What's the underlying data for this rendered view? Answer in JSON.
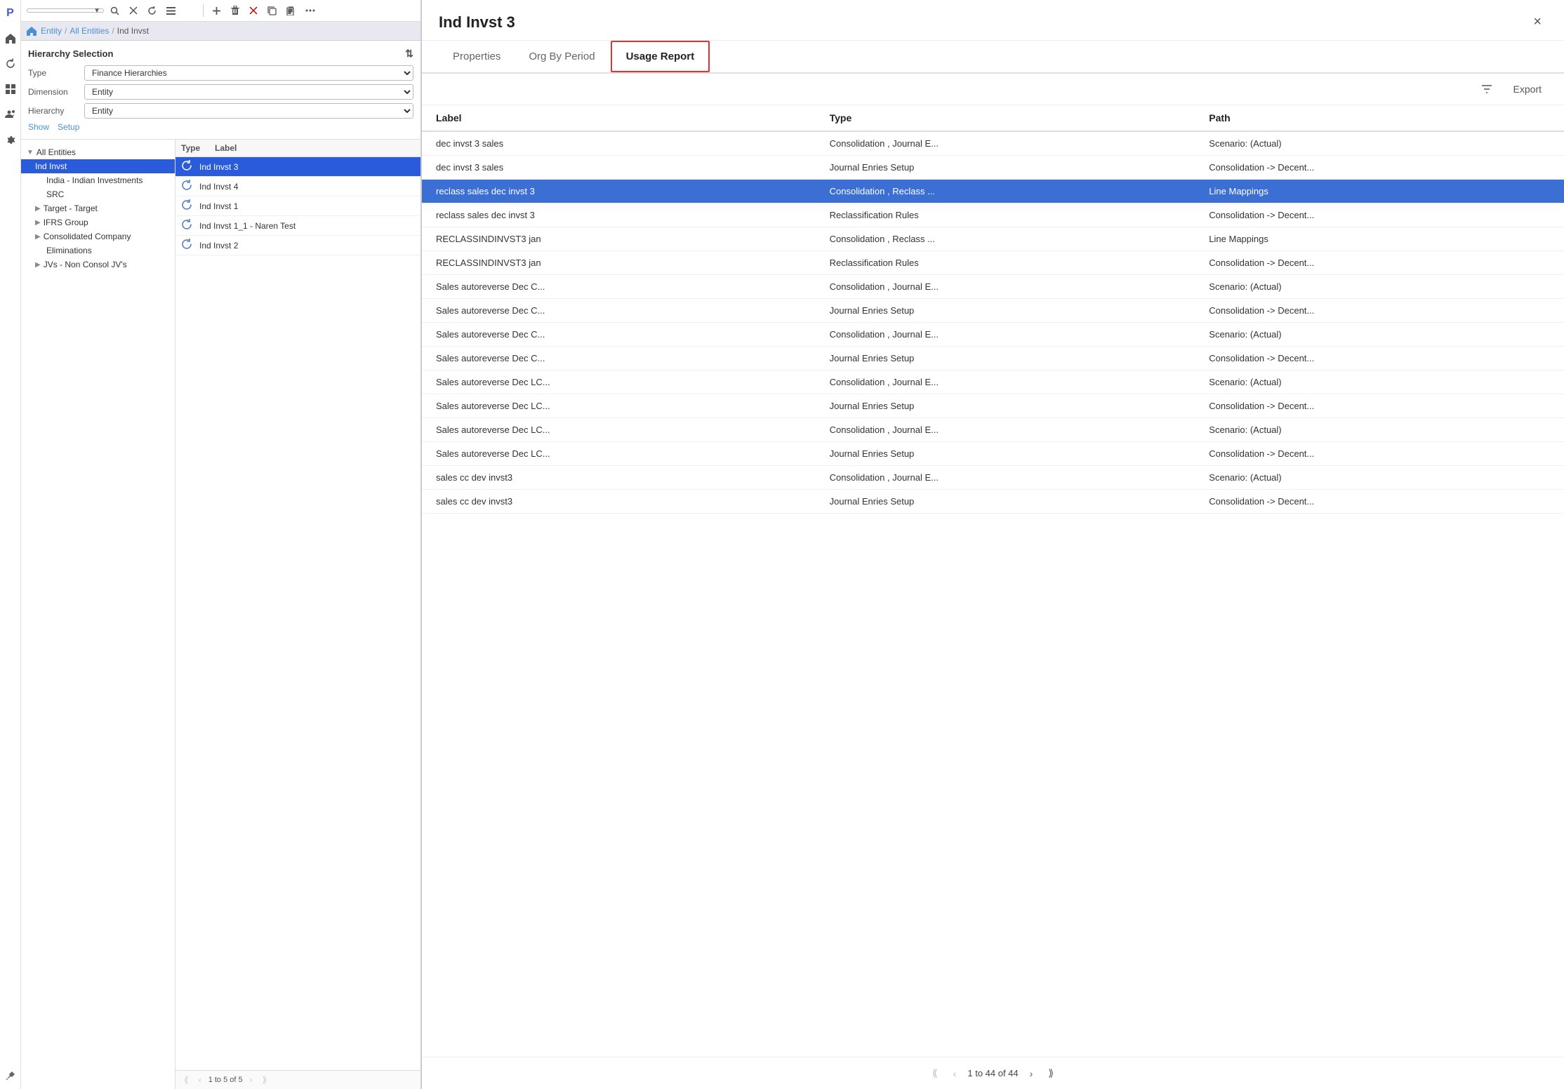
{
  "app": {
    "title": "Ind Invst 3"
  },
  "nav": {
    "icons": [
      "P",
      "🏠",
      "↺",
      "⊞",
      "👤",
      "⚙"
    ]
  },
  "toolbar": {
    "dropdown_placeholder": "",
    "buttons": [
      "search",
      "clear",
      "refresh",
      "list",
      "sort",
      "add",
      "delete",
      "x-red",
      "copy",
      "paste",
      "more"
    ]
  },
  "breadcrumb": {
    "items": [
      "Entity",
      "All Entities",
      "Ind Invst"
    ]
  },
  "hierarchy": {
    "title": "Hierarchy Selection",
    "type_label": "Type",
    "type_value": "Finance Hierarchies",
    "dimension_label": "Dimension",
    "dimension_value": "Entity",
    "hierarchy_label": "Hierarchy",
    "hierarchy_value": "Entity",
    "actions": [
      "Show",
      "Setup"
    ]
  },
  "list_header": {
    "type": "Type",
    "label": "Label"
  },
  "tree": {
    "items": [
      {
        "label": "All Entities",
        "level": 0,
        "expanded": true,
        "arrow": "▼"
      },
      {
        "label": "Ind Invst",
        "level": 1,
        "selected": true,
        "arrow": ""
      },
      {
        "label": "India - Indian Investments",
        "level": 2,
        "arrow": ""
      },
      {
        "label": "SRC",
        "level": 2,
        "arrow": ""
      },
      {
        "label": "Target - Target",
        "level": 1,
        "arrow": "▶"
      },
      {
        "label": "IFRS Group",
        "level": 1,
        "arrow": "▶"
      },
      {
        "label": "Consolidated Company",
        "level": 1,
        "arrow": "▶"
      },
      {
        "label": "Eliminations",
        "level": 2,
        "arrow": ""
      },
      {
        "label": "JVs - Non Consol JV's",
        "level": 1,
        "arrow": "▶"
      }
    ]
  },
  "list_rows": [
    {
      "icon": "🔁",
      "label": "Ind Invst 3",
      "selected": true
    },
    {
      "icon": "🔁",
      "label": "Ind Invst 4"
    },
    {
      "icon": "🔁",
      "label": "Ind Invst 1"
    },
    {
      "icon": "🔁",
      "label": "Ind Invst 1_1 - Naren Test"
    },
    {
      "icon": "🔁",
      "label": "Ind Invst 2"
    }
  ],
  "list_footer": {
    "pagination": "1 to 5 of 5"
  },
  "dialog": {
    "title": "Ind Invst 3",
    "close_label": "×",
    "tabs": [
      {
        "label": "Properties",
        "active": false
      },
      {
        "label": "Org By Period",
        "active": false
      },
      {
        "label": "Usage Report",
        "active": true
      }
    ]
  },
  "table_toolbar": {
    "filter_label": "Filter",
    "export_label": "Export"
  },
  "table": {
    "columns": [
      {
        "key": "label",
        "header": "Label"
      },
      {
        "key": "type",
        "header": "Type"
      },
      {
        "key": "path",
        "header": "Path"
      }
    ],
    "rows": [
      {
        "label": "dec invst 3 sales",
        "type": "Consolidation , Journal E...",
        "path": "Scenario: (Actual)",
        "selected": false
      },
      {
        "label": "dec invst 3 sales",
        "type": "Journal Enries Setup",
        "path": "Consolidation -> Decent...",
        "selected": false
      },
      {
        "label": "reclass sales dec invst 3",
        "type": "Consolidation , Reclass ...",
        "path": "Line Mappings",
        "selected": true
      },
      {
        "label": "reclass sales dec invst 3",
        "type": "Reclassification Rules",
        "path": "Consolidation -> Decent...",
        "selected": false
      },
      {
        "label": "RECLASSINDINVST3 jan",
        "type": "Consolidation , Reclass ...",
        "path": "Line Mappings",
        "selected": false
      },
      {
        "label": "RECLASSINDINVST3 jan",
        "type": "Reclassification Rules",
        "path": "Consolidation -> Decent...",
        "selected": false
      },
      {
        "label": "Sales autoreverse Dec C...",
        "type": "Consolidation , Journal E...",
        "path": "Scenario: (Actual)",
        "selected": false
      },
      {
        "label": "Sales autoreverse Dec C...",
        "type": "Journal Enries Setup",
        "path": "Consolidation -> Decent...",
        "selected": false
      },
      {
        "label": "Sales autoreverse Dec C...",
        "type": "Consolidation , Journal E...",
        "path": "Scenario: (Actual)",
        "selected": false
      },
      {
        "label": "Sales autoreverse Dec C...",
        "type": "Journal Enries Setup",
        "path": "Consolidation -> Decent...",
        "selected": false
      },
      {
        "label": "Sales autoreverse Dec LC...",
        "type": "Consolidation , Journal E...",
        "path": "Scenario: (Actual)",
        "selected": false
      },
      {
        "label": "Sales autoreverse Dec LC...",
        "type": "Journal Enries Setup",
        "path": "Consolidation -> Decent...",
        "selected": false
      },
      {
        "label": "Sales autoreverse Dec LC...",
        "type": "Consolidation , Journal E...",
        "path": "Scenario: (Actual)",
        "selected": false
      },
      {
        "label": "Sales autoreverse Dec LC...",
        "type": "Journal Enries Setup",
        "path": "Consolidation -> Decent...",
        "selected": false
      },
      {
        "label": "sales cc dev invst3",
        "type": "Consolidation , Journal E...",
        "path": "Scenario: (Actual)",
        "selected": false
      },
      {
        "label": "sales cc dev invst3",
        "type": "Journal Enries Setup",
        "path": "Consolidation -> Decent...",
        "selected": false
      }
    ],
    "footer": {
      "pagination": "1 to 44 of 44"
    }
  },
  "colors": {
    "selected_bg": "#3b6fd4",
    "selected_text": "#ffffff",
    "tab_active_border": "#e53030",
    "link_color": "#4a90d9"
  }
}
